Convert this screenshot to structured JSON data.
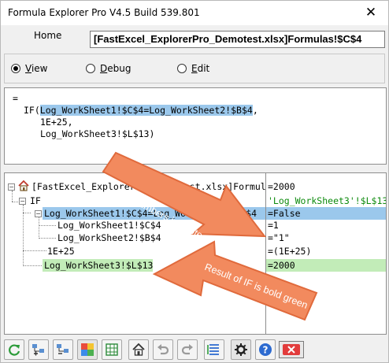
{
  "window": {
    "title": "Formula Explorer Pro V4.5 Build 539.801",
    "close_glyph": "✕"
  },
  "home": {
    "label": "Home",
    "location": "[FastExcel_ExplorerPro_Demotest.xlsx]Formulas!$C$4"
  },
  "modes": [
    {
      "label": "View",
      "selected": true
    },
    {
      "label": "Debug",
      "selected": false
    },
    {
      "label": "Edit",
      "selected": false
    }
  ],
  "formula": {
    "lines": [
      "=",
      "IF(",
      "Log_WorkSheet1!$C$4=Log_WorkSheet2!$B$4",
      ",",
      "1E+25,",
      "Log_WorkSheet3!$L$13)"
    ]
  },
  "tree": {
    "root": "[FastExcel_ExplorerPro_Demotest.xlsx]Formulas!$C$4",
    "nodes": [
      {
        "text": "IF"
      },
      {
        "text": "Log_WorkSheet1!$C$4=Log_WorkSheet2!$B$4"
      },
      {
        "text": "Log_WorkSheet1!$C$4"
      },
      {
        "text": "Log_WorkSheet2!$B$4"
      },
      {
        "text": "1E+25"
      },
      {
        "text": "Log_WorkSheet3!$L$13"
      }
    ]
  },
  "values": [
    "=2000",
    "'Log_WorkSheet3'!$L$13",
    "=False",
    "=1",
    "=\"1\"",
    "=(1E+25)",
    "=2000"
  ],
  "callouts": {
    "top": "Text numbers in quotes",
    "bottom": "Result of IF is bold green"
  },
  "toolbar": {
    "buttons": [
      "refresh-icon",
      "tree-expand-icon",
      "tree-collapse-icon",
      "color-map-icon",
      "grid-icon",
      "home-icon",
      "undo-icon",
      "redo-icon",
      "list-icon",
      "settings-icon",
      "help-icon",
      "close-icon"
    ]
  },
  "colors": {
    "selection": "#9bc8ec",
    "result_green": "#c2ecb8",
    "callout_fill": "#f28a5e",
    "close_red": "#e23c3c"
  }
}
